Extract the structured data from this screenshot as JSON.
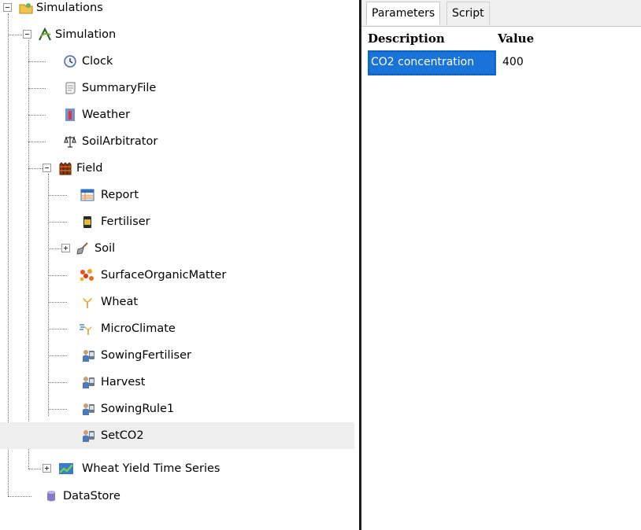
{
  "tree": {
    "root": "Simulations",
    "simulation": "Simulation",
    "clock": "Clock",
    "summary_file": "SummaryFile",
    "weather": "Weather",
    "soil_arbitrator": "SoilArbitrator",
    "field": "Field",
    "report": "Report",
    "fertiliser": "Fertiliser",
    "soil": "Soil",
    "surface_organic_matter": "SurfaceOrganicMatter",
    "wheat": "Wheat",
    "micro_climate": "MicroClimate",
    "sowing_fertiliser": "SowingFertiliser",
    "harvest": "Harvest",
    "sowing_rule1": "SowingRule1",
    "set_co2": "SetCO2",
    "wheat_yield_time_series": "Wheat Yield Time Series",
    "data_store": "DataStore"
  },
  "tabs": {
    "parameters": "Parameters",
    "script": "Script"
  },
  "grid": {
    "headers": {
      "description": "Description",
      "value": "Value"
    },
    "rows": [
      {
        "description": "CO2 concentration",
        "value": "400"
      }
    ]
  },
  "colors": {
    "selection": "#1a73d9",
    "selected_row": "#eeeeee"
  }
}
